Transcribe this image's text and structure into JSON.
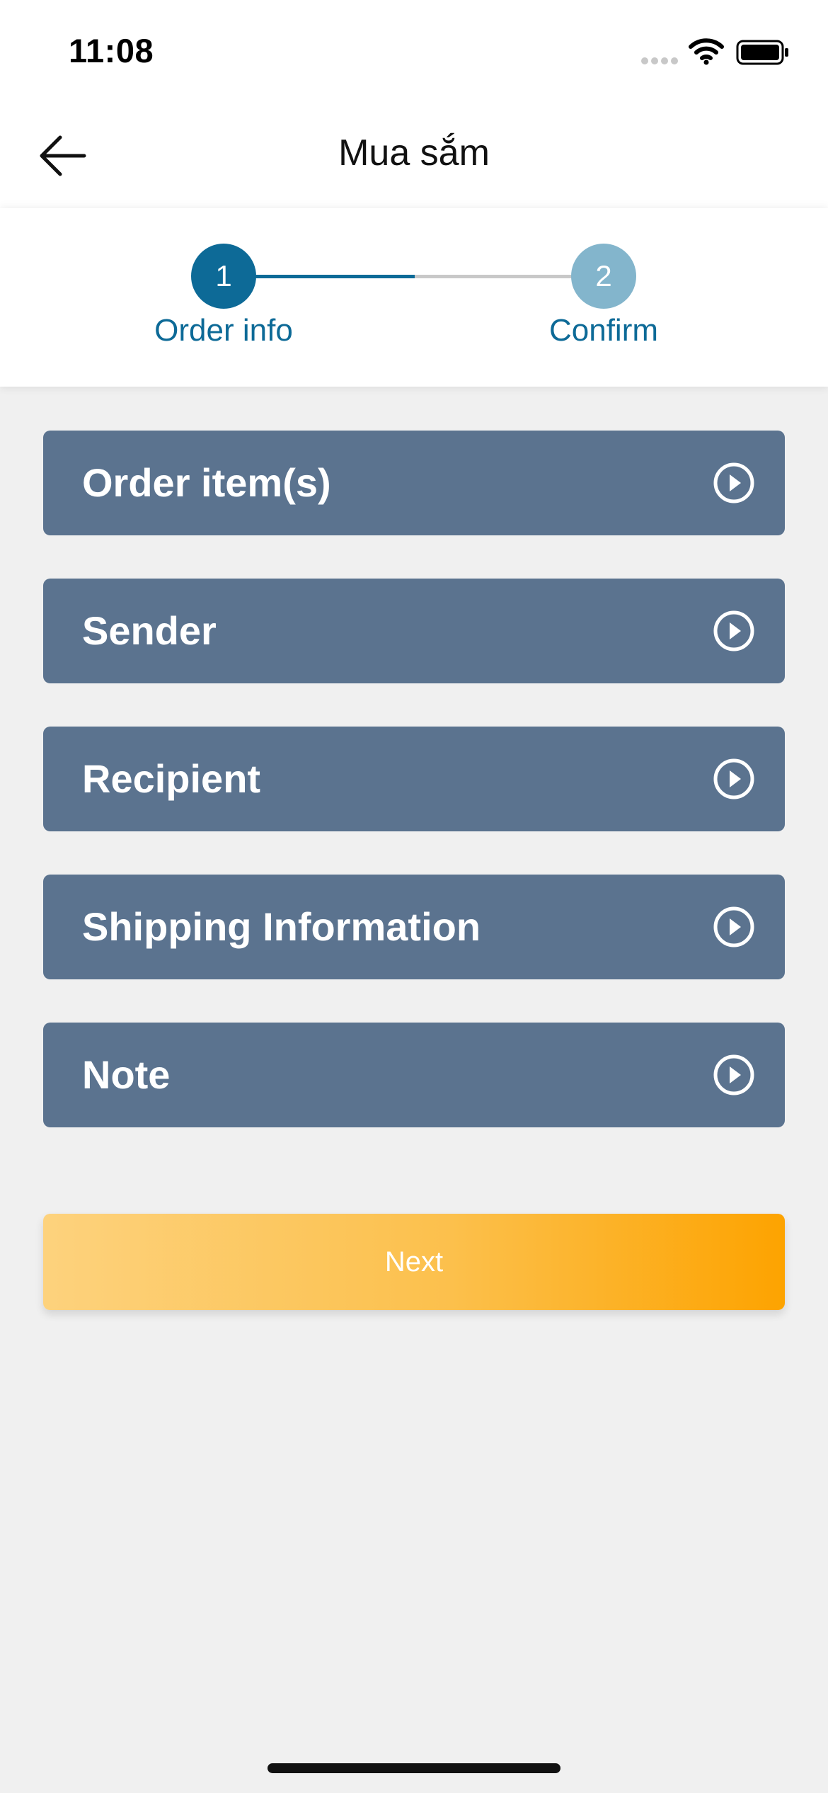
{
  "status_bar": {
    "time": "11:08"
  },
  "header": {
    "title": "Mua sắm",
    "back_icon": "arrow-left-icon"
  },
  "stepper": {
    "steps": [
      {
        "number": "1",
        "label": "Order info",
        "state": "active"
      },
      {
        "number": "2",
        "label": "Confirm",
        "state": "inactive"
      }
    ]
  },
  "sections": [
    {
      "label": "Order item(s)",
      "icon": "play-circle-icon"
    },
    {
      "label": "Sender",
      "icon": "play-circle-icon"
    },
    {
      "label": "Recipient",
      "icon": "play-circle-icon"
    },
    {
      "label": "Shipping Information",
      "icon": "play-circle-icon"
    },
    {
      "label": "Note",
      "icon": "play-circle-icon"
    }
  ],
  "actions": {
    "next_label": "Next"
  },
  "colors": {
    "primary": "#0d6a97",
    "step_inactive": "#83b5cc",
    "section_bg": "#5b738f",
    "button_gradient_start": "#fdd27d",
    "button_gradient_end": "#fda300",
    "page_bg": "#f0f0f0"
  }
}
